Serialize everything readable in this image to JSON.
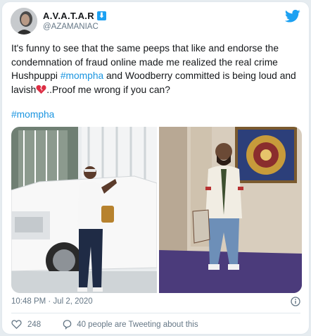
{
  "author": {
    "display_name": "A.V.A.T.A.R",
    "badge_icon": "down-arrow-badge-icon",
    "handle": "@AZAMANIAC"
  },
  "tweet": {
    "text_part1": "It's funny to see that the same peeps that like and endorse the condemnation of fraud online made me realized the real crime Hushpuppi ",
    "hashtag1": "#mompha",
    "text_part2": " and Woodberry committed is being loud and lavish",
    "emoji": "broken-heart-icon",
    "text_part3": "..Proof me wrong if you can?",
    "hashtag2": "#mompha"
  },
  "meta": {
    "timestamp": "10:48 PM · Jul 2, 2020"
  },
  "footer": {
    "likes": "248",
    "replies": "40 people are Tweeting about this"
  },
  "colors": {
    "brand": "#1da1f2",
    "link": "#1b95e0",
    "muted": "#657786"
  }
}
